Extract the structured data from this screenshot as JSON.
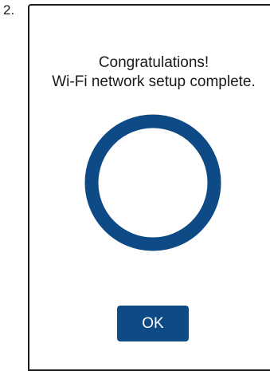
{
  "step": {
    "number": "2."
  },
  "dialog": {
    "message_line1": "Congratulations!",
    "message_line2": "Wi-Fi network setup complete.",
    "ok_label": "OK"
  },
  "colors": {
    "accent": "#0d4a86",
    "frame": "#1a1a1a",
    "background": "#ffffff"
  },
  "icons": {
    "status_indicator": "complete-ring-icon"
  }
}
